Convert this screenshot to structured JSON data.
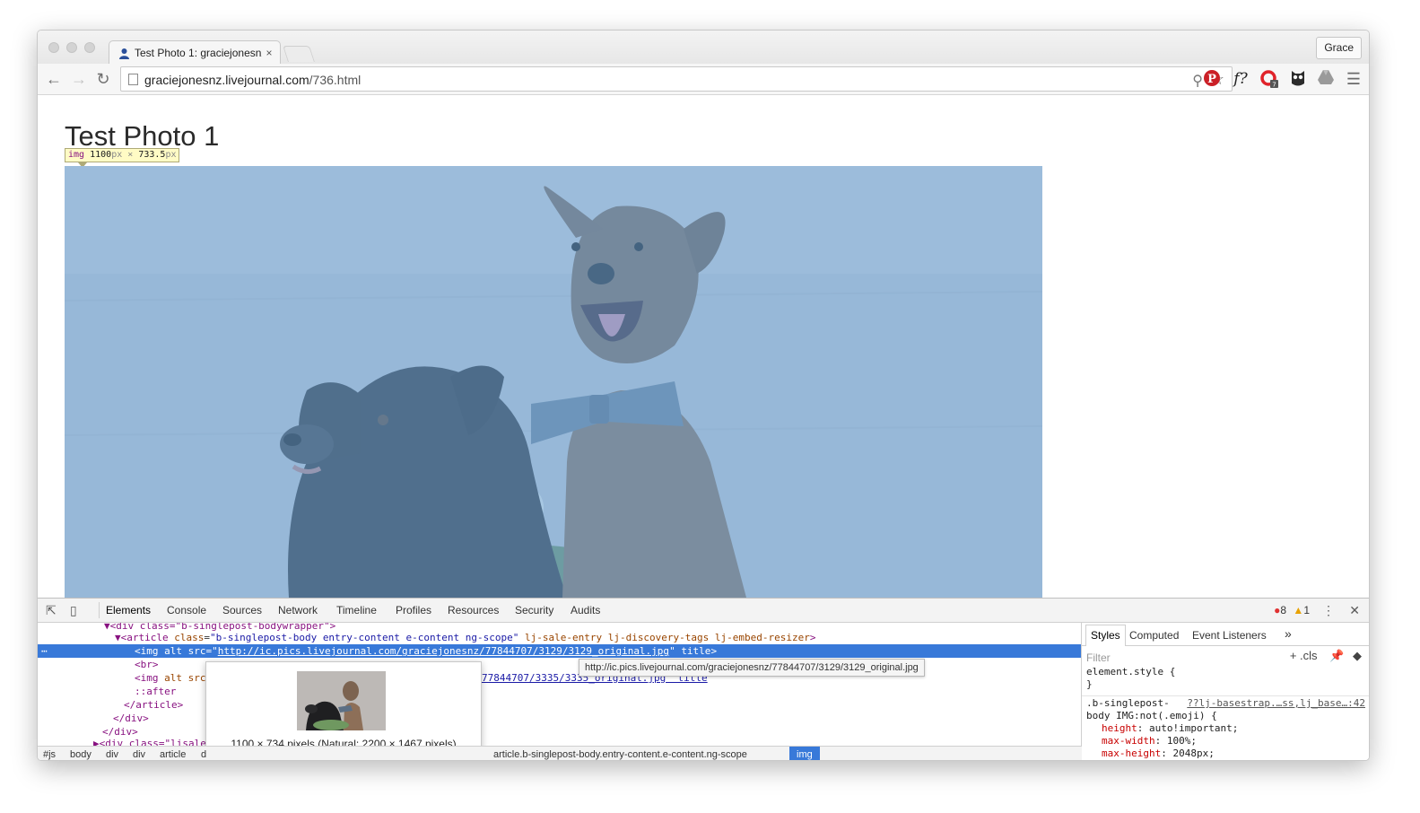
{
  "browser": {
    "tab_title": "Test Photo 1: graciejonesnz",
    "tab_close": "×",
    "profile_name": "Grace",
    "url_host": "graciejonesnz.livejournal.com",
    "url_path": "/736.html",
    "extensions": [
      "pinterest-icon",
      "font-identifier-icon",
      "opera-icon",
      "owl-icon",
      "drive-icon",
      "menu-icon"
    ],
    "ext_f": "f?",
    "opera_badge": "7"
  },
  "page": {
    "title": "Test Photo 1",
    "inspect_tip": {
      "tag": "img",
      "width": "1100",
      "height": "733.5",
      "unit": "px",
      "sep": "×"
    }
  },
  "devtools": {
    "tabs": [
      "Elements",
      "Console",
      "Sources",
      "Network",
      "Timeline",
      "Profiles",
      "Resources",
      "Security",
      "Audits"
    ],
    "errors": "8",
    "warnings": "1",
    "dom_lines": [
      "▼<div class=\"b-singlepost-bodywrapper\">",
      "▼<article class=\"b-singlepost-body entry-content e-content  ng-scope\" lj-sale-entry lj-discovery-tags lj-embed-resizer>",
      "<img alt src=\"http://ic.pics.livejournal.com/graciejonesnz/77844707/3129/3129_original.jpg\" title>",
      "<br>",
      "<img alt src",
      "77844707/3335/3335_original.jpg\" title",
      "::after",
      "</article>",
      "</div>",
      "</div>",
      "▶<div class=\"lisale"
    ],
    "selected_src": "http://ic.pics.livejournal.com/graciejonesnz/77844707/3129/3129_original.jpg",
    "url_tooltip": "http://ic.pics.livejournal.com/graciejonesnz/77844707/3129/3129_original.jpg",
    "image_caption": "1100 × 734 pixels (Natural: 2200 × 1467 pixels)",
    "breadcrumbs": [
      "#js",
      "body",
      "div",
      "div",
      "article",
      "d",
      "article.b-singlepost-body.entry-content.e-content.ng-scope",
      "img"
    ],
    "styles_tabs": [
      "Styles",
      "Computed",
      "Event Listeners",
      "»"
    ],
    "filter_placeholder": "Filter",
    "filter_tools": "+ .cls",
    "element_style_open": "element.style {",
    "element_style_close": "}",
    "rule_selector_1": ".b-singlepost-",
    "rule_selector_2": "body IMG:not(.emoji) {",
    "rule_source": "??lj-basestrap.…ss,lj_base…:42",
    "rule_props": [
      {
        "name": "height",
        "value": "auto!important;"
      },
      {
        "name": "max-width",
        "value": "100%;"
      },
      {
        "name": "max-height",
        "value": "2048px;"
      }
    ]
  }
}
